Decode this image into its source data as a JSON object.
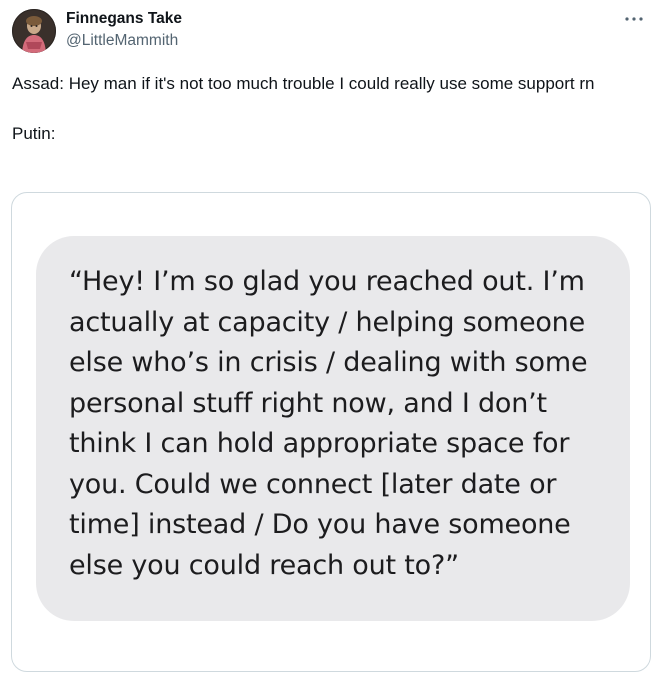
{
  "author": {
    "display_name": "Finnegans Take",
    "handle": "@LittleMammith",
    "avatar_icon": "avatar-image"
  },
  "menu": {
    "more_icon": "ellipsis-icon"
  },
  "tweet": {
    "line1": "Assad: Hey man if it's not too much trouble I could really use some support rn",
    "line2": "Putin:"
  },
  "media": {
    "message_text": "“Hey! I’m so glad you reached out. I’m actually at capacity / helping someone else who’s in crisis / dealing with some personal stuff right now, and I don’t think I can hold appropriate space for you. Could we connect [later date or time] instead / Do you have someone else you could reach out to?”",
    "bubble_color": "#e9e9eb",
    "border_color": "#cfd9de"
  },
  "colors": {
    "text_primary": "#0f1419",
    "text_secondary": "#536471"
  }
}
